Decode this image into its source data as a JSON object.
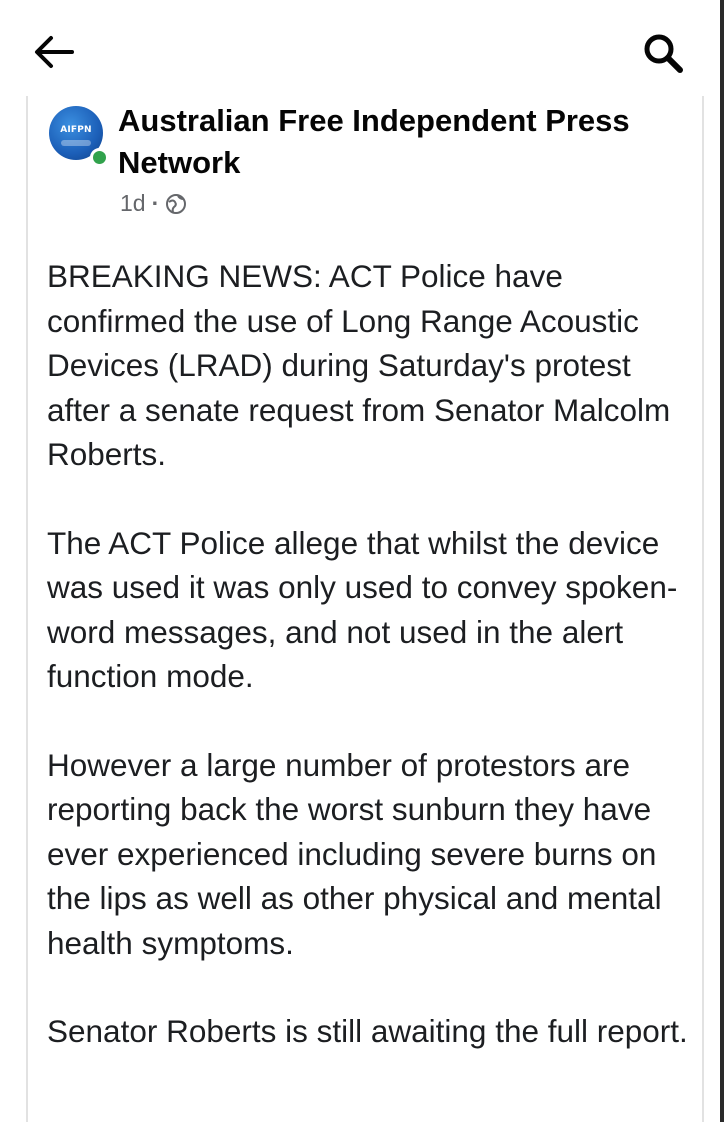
{
  "topbar": {
    "back_icon": "arrow-left-icon",
    "search_icon": "search-icon"
  },
  "post": {
    "page_name": "Australian Free Independent Press Network",
    "avatar_text": "AIFPN",
    "timestamp": "1d",
    "separator": "·",
    "privacy_icon": "globe-icon",
    "paragraphs": [
      "BREAKING NEWS: ACT Police have confirmed the use of Long Range Acoustic Devices (LRAD) during Saturday's protest after a senate request from Senator Malcolm Roberts.",
      "The ACT Police allege that whilst the device was used it was only used to convey spoken-word messages, and not used in the alert function mode.",
      "However a large number of protestors are reporting back the worst sunburn they have ever experienced including severe burns on the lips as well as other physical and mental health symptoms.",
      "Senator Roberts is still awaiting the full report."
    ]
  },
  "colors": {
    "text_primary": "#050505",
    "text_secondary": "#65676b",
    "online_green": "#31a24c",
    "avatar_blue": "#1c5fb8"
  }
}
